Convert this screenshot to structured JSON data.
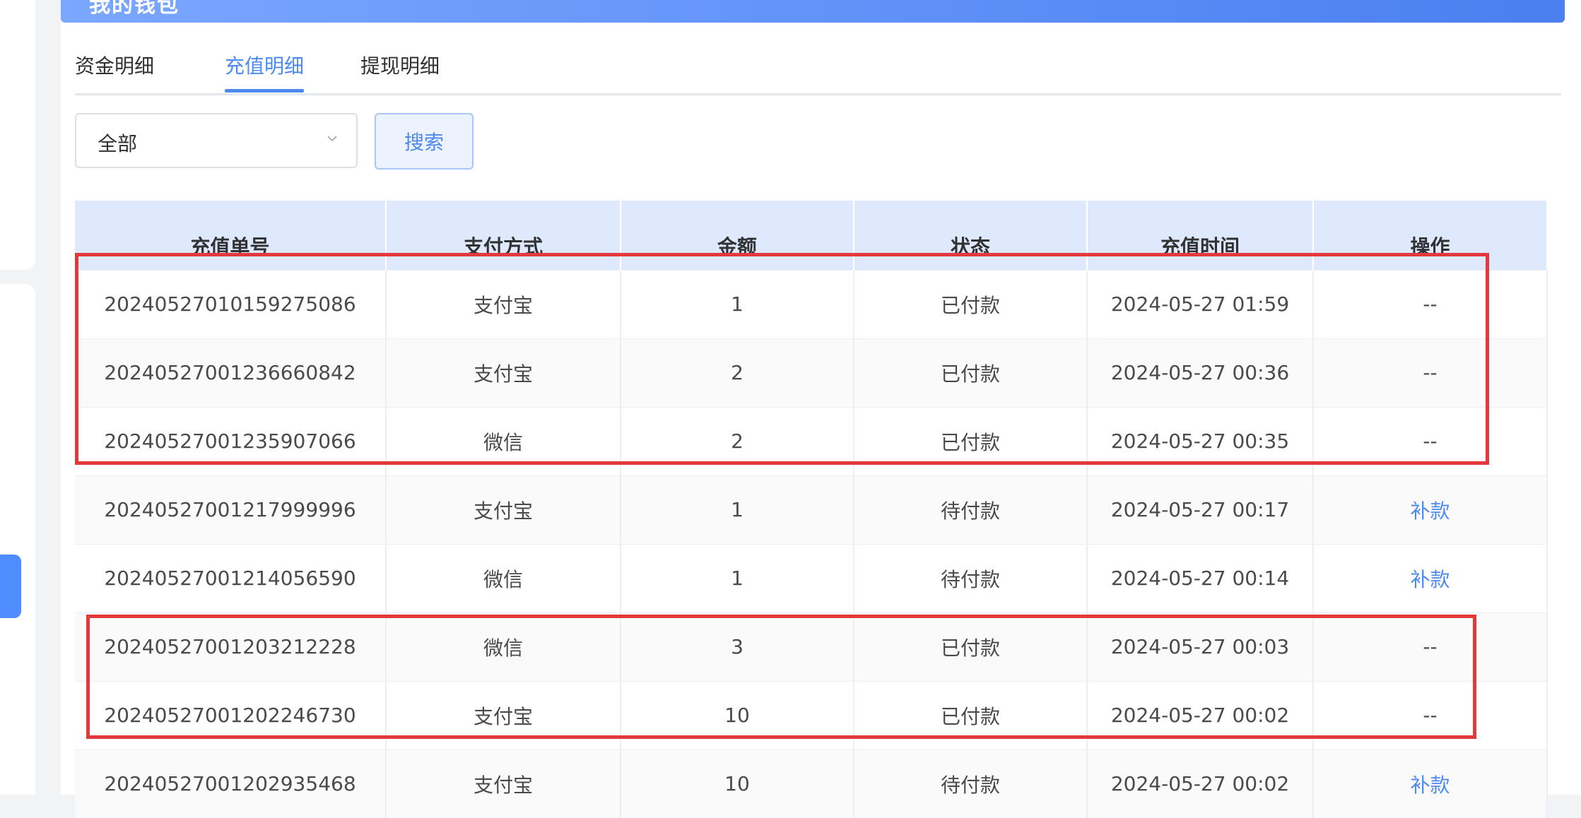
{
  "wallet": {
    "title": "我的钱包"
  },
  "tabs": [
    {
      "label": "资金明细"
    },
    {
      "label": "充值明细"
    },
    {
      "label": "提现明细"
    }
  ],
  "filter": {
    "status_value": "全部",
    "search_label": "搜索"
  },
  "table": {
    "columns": [
      "充值单号",
      "支付方式",
      "金额",
      "状态",
      "充值时间",
      "操作"
    ],
    "rows": [
      {
        "order_no": "2024052701015927508​6",
        "method": "支付宝",
        "amount": "1",
        "status": "已付款",
        "time": "2024-05-27 01:59",
        "action": "--"
      },
      {
        "order_no": "20240527001236660842",
        "method": "支付宝",
        "amount": "2",
        "status": "已付款",
        "time": "2024-05-27 00:36",
        "action": "--"
      },
      {
        "order_no": "20240527001235907066",
        "method": "微信",
        "amount": "2",
        "status": "已付款",
        "time": "2024-05-27 00:35",
        "action": "--"
      },
      {
        "order_no": "20240527001217999996",
        "method": "支付宝",
        "amount": "1",
        "status": "待付款",
        "time": "2024-05-27 00:17",
        "action": "补款"
      },
      {
        "order_no": "20240527001214056590",
        "method": "微信",
        "amount": "1",
        "status": "待付款",
        "time": "2024-05-27 00:14",
        "action": "补款"
      },
      {
        "order_no": "20240527001203212228",
        "method": "微信",
        "amount": "3",
        "status": "已付款",
        "time": "2024-05-27 00:03",
        "action": "--"
      },
      {
        "order_no": "20240527001202246730",
        "method": "支付宝",
        "amount": "10",
        "status": "已付款",
        "time": "2024-05-27 00:02",
        "action": "--"
      },
      {
        "order_no": "20240527001202935468",
        "method": "支付宝",
        "amount": "10",
        "status": "待付款",
        "time": "2024-05-27 00:02",
        "action": "补款"
      }
    ]
  }
}
